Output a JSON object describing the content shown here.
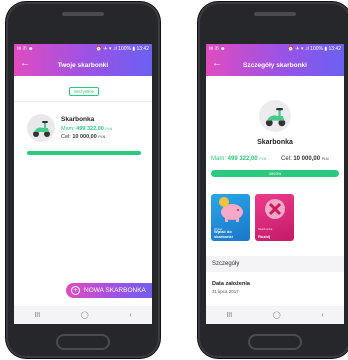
{
  "status_left": {
    "icons": "✉ ✆ ☻",
    "right": "⏰ ✈ ▾ .ıl 100% ▮ 13:42"
  },
  "status_right": {
    "icons": "✉ ✆ ☻",
    "right": "⏰ ✈ ▾ .ıl 100% ▮ 13:42"
  },
  "left_screen": {
    "title": "Twoje skarbonki",
    "filter_label": "Wszystkie",
    "card": {
      "name": "Skarbonka",
      "mam_label": "Mam:",
      "mam_value": "499 322,00",
      "mam_currency": "PLN",
      "cel_label": "Cel:",
      "cel_value": "10 000,00",
      "cel_currency": "PLN"
    },
    "fab_plus": "+",
    "fab_label": "NOWA SKARBONKA"
  },
  "right_screen": {
    "title": "Szczegóły skarbonki",
    "name": "Skarbonka",
    "mam_label": "Mam:",
    "mam_value": "499 322,00",
    "mam_currency": "PLN",
    "cel_label": "Cel:",
    "cel_value": "10 000,00",
    "cel_currency": "PLN",
    "progress_label": "4993%",
    "tile1_small": "Wpłać",
    "tile1_label": "Wpłać do skarbonki",
    "tile2_small": "Skarbonka",
    "tile2_label": "Rozbij",
    "section_label": "Szczegóły",
    "date_label": "Data założenia",
    "date_value": "31 lipca 2017"
  },
  "nav": {
    "recent": "III",
    "home": "◯",
    "back": "‹"
  },
  "colors": {
    "accent_green": "#2bc97d",
    "gradient_start": "#e04cc0",
    "gradient_end": "#6a61f2",
    "highlight": "#e0303a"
  },
  "icons": {
    "back": "arrow-left-icon",
    "scooter": "scooter-icon",
    "piggy": "piggy-bank-icon",
    "break": "close-icon"
  }
}
